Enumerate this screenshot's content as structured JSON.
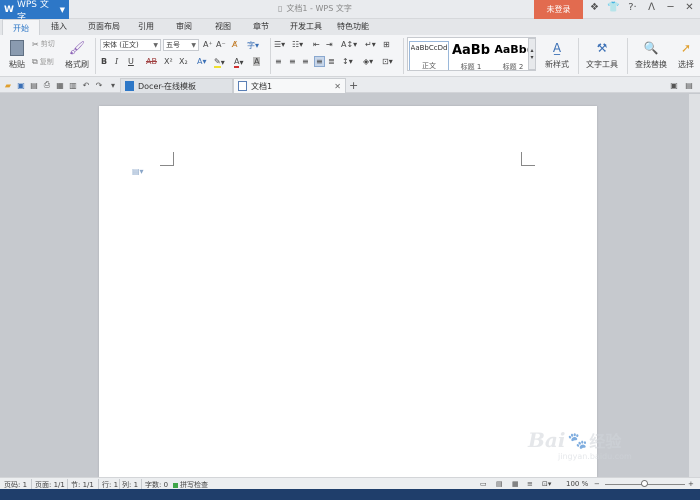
{
  "app": {
    "logo": "W",
    "name": "WPS 文字",
    "title_text": "文档1 - WPS 文字",
    "login": "未登录"
  },
  "window_icons": [
    "gear-icon",
    "shirt-icon",
    "help-icon",
    "minimize-icon",
    "restore-icon",
    "close-icon"
  ],
  "window_glyphs": [
    "❖",
    "👕",
    "?·",
    "ᐱ",
    "─",
    "✕"
  ],
  "tabs": [
    "开始",
    "插入",
    "页面布局",
    "引用",
    "审阅",
    "视图",
    "章节",
    "开发工具",
    "特色功能"
  ],
  "ribbon": {
    "paste": "粘贴",
    "cut": "剪切",
    "copy": "复制",
    "format_painter": "格式刷",
    "font_name": "宋体 (正文)",
    "font_size": "五号",
    "bold": "B",
    "italic": "I",
    "underline": "U",
    "strike": "AB",
    "superscript": "X²",
    "subscript": "X₂",
    "styles": [
      {
        "sample": "AaBbCcDd",
        "label": "正文"
      },
      {
        "sample": "AaBb",
        "label": "标题 1"
      },
      {
        "sample": "AaBb(",
        "label": "标题 2"
      }
    ],
    "new_style": "新样式",
    "text_tools": "文字工具",
    "find_replace": "查找替换",
    "select": "选择"
  },
  "doc_tabs": [
    {
      "label": "Docer-在线模板"
    },
    {
      "label": "文档1"
    }
  ],
  "status": {
    "page_num": "页码: 1",
    "pages": "页面: 1/1",
    "section": "节: 1/1",
    "row": "行: 1",
    "col": "列: 1",
    "words": "字数: 0",
    "spell": "拼写检查",
    "zoom": "100 %",
    "zoom_level": 0.5
  },
  "watermark": {
    "brand": "Bai",
    "brand2": "经验",
    "url": "jingyan.baidu.com"
  }
}
